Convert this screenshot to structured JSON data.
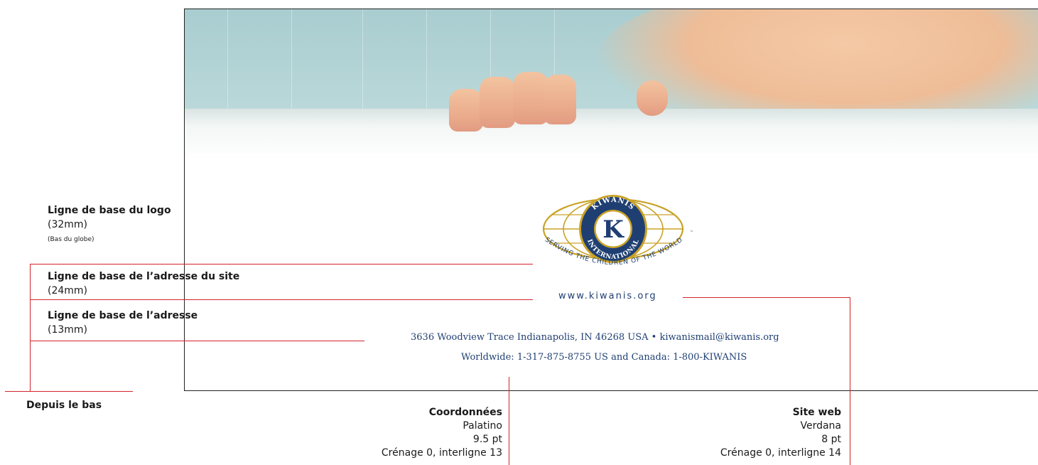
{
  "labels": {
    "logo_baseline": {
      "title": "Ligne de base du logo",
      "value": "(32mm)",
      "note": "(Bas du globe)"
    },
    "site_baseline": {
      "title": "Ligne de base de l’adresse du site",
      "value": "(24mm)"
    },
    "address_baseline": {
      "title": "Ligne de base de l’adresse",
      "value": "(13mm)"
    },
    "from_bottom": "Depuis le bas"
  },
  "logo": {
    "ring_top": "KIWANIS",
    "ring_bottom": "INTERNATIONAL",
    "letter": "K",
    "tagline": "SERVING THE CHILDREN OF THE WORLD",
    "tm": "™"
  },
  "letterhead": {
    "website": "www.kiwanis.org",
    "address_line1": "3636 Woodview Trace  Indianapolis, IN 46268 USA  •  kiwanismail@kiwanis.org",
    "address_line2": "Worldwide: 1-317-875-8755  US and Canada: 1-800-KIWANIS"
  },
  "specs": {
    "contact": {
      "title": "Coordonnées",
      "font": "Palatino",
      "size": "9.5 pt",
      "spacing": "Crénage 0, interligne 13"
    },
    "web": {
      "title": "Site web",
      "font": "Verdana",
      "size": "8 pt",
      "spacing": "Crénage 0, interligne 14"
    }
  },
  "colors": {
    "guide_red": "#d2232a",
    "kiwanis_blue": "#1f3f73",
    "kiwanis_gold": "#c9a227"
  }
}
